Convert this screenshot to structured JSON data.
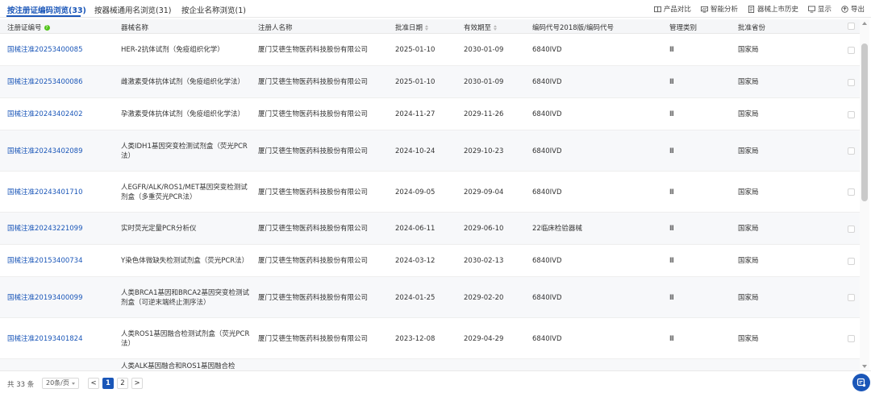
{
  "tabs": [
    {
      "label": "按注册证编码浏览(33)",
      "active": true
    },
    {
      "label": "按器械通用名浏览(31)",
      "active": false
    },
    {
      "label": "按企业名称浏览(1)",
      "active": false
    }
  ],
  "tools": {
    "compare": "产品对比",
    "smart_analysis": "智能分析",
    "history": "器械上市历史",
    "display": "显示",
    "export": "导出"
  },
  "columns": {
    "reg_no": "注册证编号",
    "device_name": "器械名称",
    "registrant": "注册人名称",
    "approve_date": "批准日期",
    "valid_until": "有效期至",
    "class_code": "编码代号2018版/编码代号",
    "mgmt_class": "管理类别",
    "approve_province": "批准省份"
  },
  "rows": [
    {
      "reg_no": "国械注准20253400085",
      "device_name": "HER-2抗体试剂（免疫组织化学）",
      "registrant": "厦门艾德生物医药科技股份有限公司",
      "approve_date": "2025-01-10",
      "valid_until": "2030-01-09",
      "class_code": "6840IVD",
      "mgmt_class": "Ⅲ",
      "province": "国家局"
    },
    {
      "reg_no": "国械注准20253400086",
      "device_name": "雌激素受体抗体试剂（免疫组织化学法）",
      "registrant": "厦门艾德生物医药科技股份有限公司",
      "approve_date": "2025-01-10",
      "valid_until": "2030-01-09",
      "class_code": "6840IVD",
      "mgmt_class": "Ⅲ",
      "province": "国家局"
    },
    {
      "reg_no": "国械注准20243402402",
      "device_name": "孕激素受体抗体试剂（免疫组织化学法）",
      "registrant": "厦门艾德生物医药科技股份有限公司",
      "approve_date": "2024-11-27",
      "valid_until": "2029-11-26",
      "class_code": "6840IVD",
      "mgmt_class": "Ⅲ",
      "province": "国家局"
    },
    {
      "reg_no": "国械注准20243402089",
      "device_name": "人类IDH1基因突变检测试剂盒（荧光PCR法）",
      "registrant": "厦门艾德生物医药科技股份有限公司",
      "approve_date": "2024-10-24",
      "valid_until": "2029-10-23",
      "class_code": "6840IVD",
      "mgmt_class": "Ⅲ",
      "province": "国家局"
    },
    {
      "reg_no": "国械注准20243401710",
      "device_name": "人EGFR/ALK/ROS1/MET基因突变检测试剂盒（多重荧光PCR法）",
      "registrant": "厦门艾德生物医药科技股份有限公司",
      "approve_date": "2024-09-05",
      "valid_until": "2029-09-04",
      "class_code": "6840IVD",
      "mgmt_class": "Ⅲ",
      "province": "国家局"
    },
    {
      "reg_no": "国械注准20243221099",
      "device_name": "实时荧光定量PCR分析仪",
      "registrant": "厦门艾德生物医药科技股份有限公司",
      "approve_date": "2024-06-11",
      "valid_until": "2029-06-10",
      "class_code": "22临床检验器械",
      "mgmt_class": "Ⅲ",
      "province": "国家局"
    },
    {
      "reg_no": "国械注准20153400734",
      "device_name": "Y染色体微缺失检测试剂盒（荧光PCR法）",
      "registrant": "厦门艾德生物医药科技股份有限公司",
      "approve_date": "2024-03-12",
      "valid_until": "2030-02-13",
      "class_code": "6840IVD",
      "mgmt_class": "Ⅲ",
      "province": "国家局"
    },
    {
      "reg_no": "国械注准20193400099",
      "device_name": "人类BRCA1基因和BRCA2基因突变检测试剂盒（可逆末端终止测序法）",
      "registrant": "厦门艾德生物医药科技股份有限公司",
      "approve_date": "2024-01-25",
      "valid_until": "2029-02-20",
      "class_code": "6840IVD",
      "mgmt_class": "Ⅲ",
      "province": "国家局"
    },
    {
      "reg_no": "国械注准20193401824",
      "device_name": "人类ROS1基因融合检测试剂盒（荧光PCR法）",
      "registrant": "厦门艾德生物医药科技股份有限公司",
      "approve_date": "2023-12-08",
      "valid_until": "2029-04-29",
      "class_code": "6840IVD",
      "mgmt_class": "Ⅲ",
      "province": "国家局"
    },
    {
      "reg_no": "",
      "device_name": "人类ALK基因融合和ROS1基因融合检",
      "registrant": "",
      "approve_date": "",
      "valid_until": "",
      "class_code": "",
      "mgmt_class": "",
      "province": ""
    }
  ],
  "footer": {
    "total": "共 33 条",
    "page_size": "20条/页",
    "prev": "<",
    "pages": [
      "1",
      "2"
    ],
    "next": ">"
  }
}
